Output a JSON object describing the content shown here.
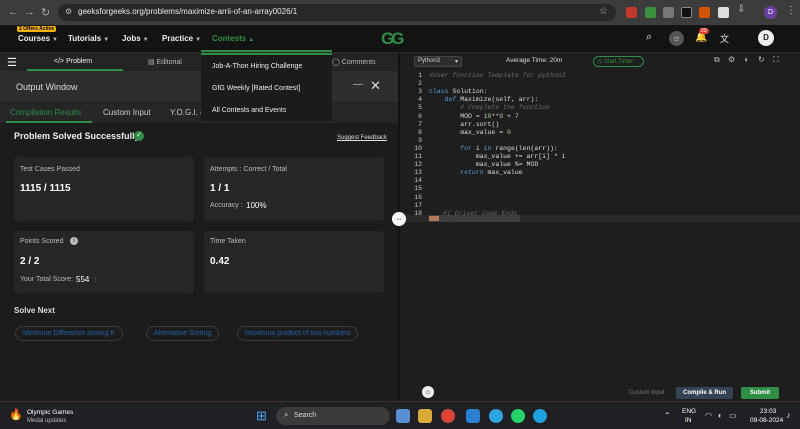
{
  "browser": {
    "profile_badge": "D",
    "url": "geeksforgeeks.org/problems/maximize-arrii-of-an-array0026/1"
  },
  "site_nav": {
    "badge": "2 Offers Active",
    "items": [
      "Courses",
      "Tutorials",
      "Jobs",
      "Practice",
      "Contests"
    ],
    "logo": "GG",
    "notifications": "23",
    "avatar": "D"
  },
  "contests_dropdown": [
    "Job-A-Thon Hiring Challenge",
    "GfG Weekly [Rated Contest]",
    "All Contests and Events"
  ],
  "left_tabs": {
    "problem": "</> Problem",
    "editorial": "Editorial",
    "comments": "Comments"
  },
  "output": {
    "title": "Output Window",
    "tabs": [
      "Compilation Results",
      "Custom Input",
      "Y.O.G.I. (A"
    ],
    "status": "Problem Solved Successfully",
    "feedback": "Suggest Feedback",
    "test_label": "Test Cases Passed",
    "test_value": "1115 / 1115",
    "attempts_label": "Attempts : Correct / Total",
    "attempts_value": "1 / 1",
    "accuracy_label": "Accuracy :",
    "accuracy_value": "100%",
    "points_label": "Points Scored",
    "points_value": "2 / 2",
    "score_label": "Your Total Score:",
    "score_value": "554",
    "time_label": "Time Taken",
    "time_value": "0.42",
    "solve_next": "Solve Next",
    "suggestions": [
      "Minimum Difference among K",
      "Alternative Sorting",
      "Maximum product of two numbers"
    ]
  },
  "editor": {
    "language": "Python3",
    "avg_time": "Average Time: 20m",
    "timer": "Start Timer",
    "custom_input": "Custom Input",
    "compile": "Compile & Run",
    "submit": "Submit",
    "lines": [
      "#User function Template for python3",
      "",
      "class Solution:",
      "    def Maximize(self, arr):",
      "        # Complete the function",
      "        MOD = 10**9 + 7",
      "        arr.sort()",
      "        max_value = 0",
      "",
      "        for i in range(len(arr)):",
      "            max_value += arr[i] * i",
      "            max_value %= MOD",
      "        return max_value",
      "",
      "",
      "",
      "",
      "#{ Driver Code Ends"
    ]
  },
  "taskbar": {
    "weather_title": "Olympic Games",
    "weather_sub": "Medal updates",
    "search": "Search",
    "lang_top": "ENG",
    "lang_bottom": "IN",
    "time": "23:03",
    "date": "09-08-2024"
  },
  "colors": {
    "accent": "#2f8d46",
    "link": "#1e5fa8",
    "brand_bg": "#131313"
  }
}
